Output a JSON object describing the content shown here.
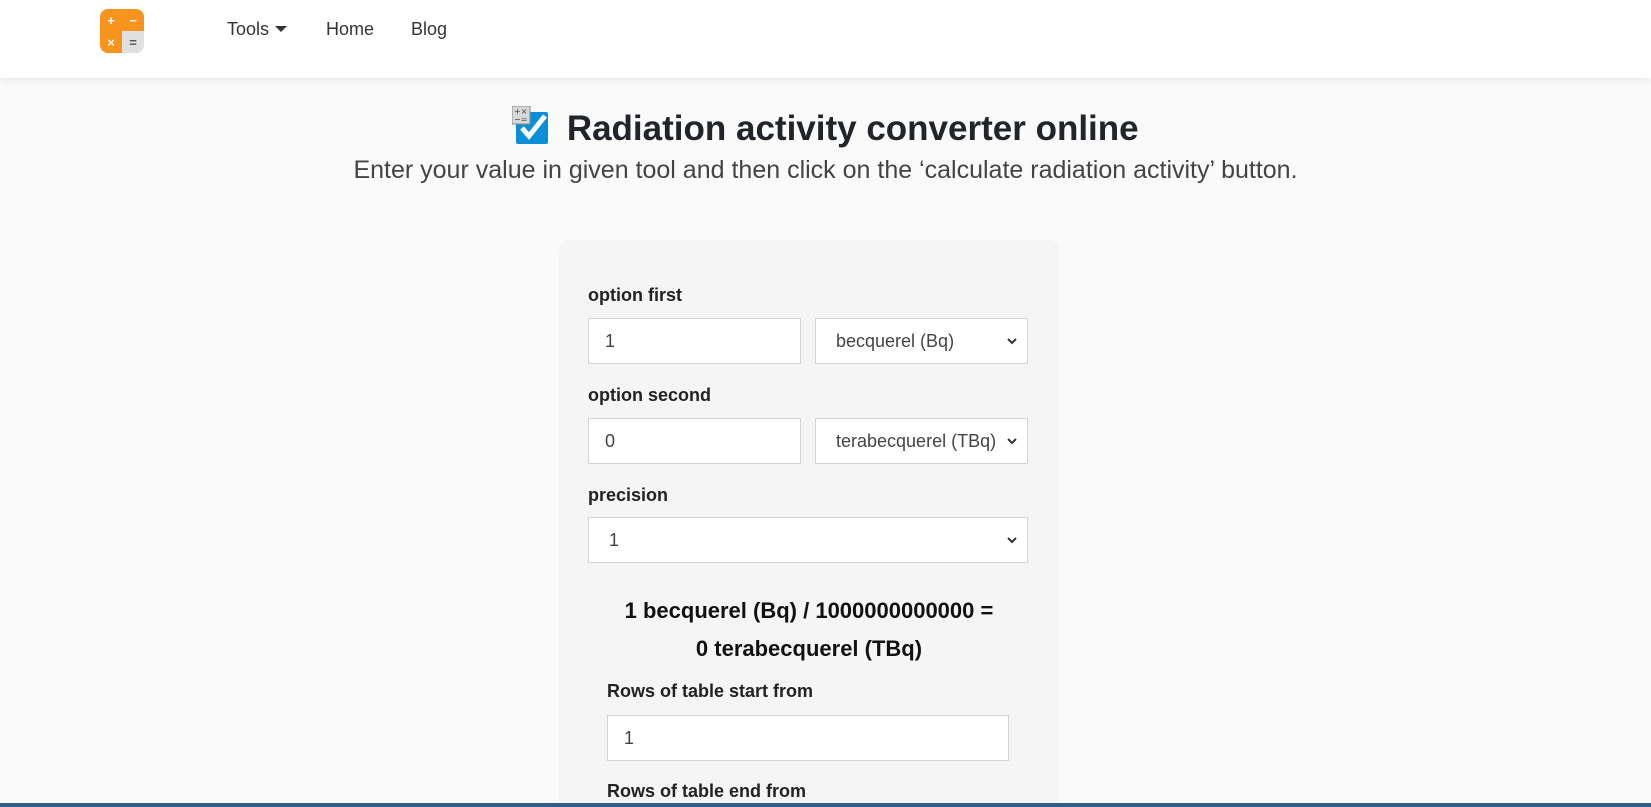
{
  "nav": {
    "logo_symbols": [
      "+",
      "−",
      "×",
      "="
    ],
    "items": [
      {
        "label": "Tools"
      },
      {
        "label": "Home"
      },
      {
        "label": "Blog"
      }
    ]
  },
  "page": {
    "title": "Radiation activity converter online",
    "subtitle": "Enter your value in given tool and then click on the ‘calculate radiation activity’ button."
  },
  "form": {
    "option_first": {
      "label": "option first",
      "value": "1",
      "unit": "becquerel (Bq)"
    },
    "option_second": {
      "label": "option second",
      "value": "0",
      "unit": "terabecquerel (TBq)"
    },
    "precision": {
      "label": "precision",
      "value": "1"
    },
    "result_line1": "1 becquerel (Bq) / 1000000000000 =",
    "result_line2": "0 terabecquerel (TBq)",
    "rows_start": {
      "label": "Rows of table start from",
      "value": "1"
    },
    "rows_end": {
      "label": "Rows of table end from"
    }
  },
  "colors": {
    "accent": "#f7941d",
    "icon_blue": "#0b8fd6",
    "bottom_bar": "#2d5f8a"
  }
}
